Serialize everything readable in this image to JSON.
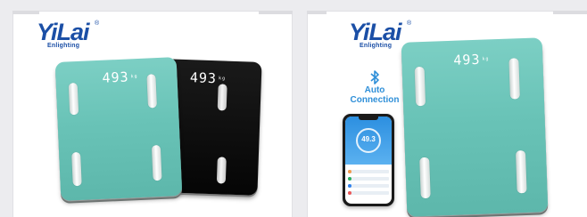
{
  "left_card": {
    "logo": {
      "wordmark": "YiLai",
      "tagline": "Enlighting",
      "reg_mark": "®"
    },
    "teal_scale": {
      "reading": "493",
      "unit": "kg",
      "color": "#69c3b7"
    },
    "black_scale": {
      "reading": "493",
      "unit": "kg",
      "color": "#0a0a0a"
    }
  },
  "right_card": {
    "logo": {
      "wordmark": "YiLai",
      "tagline": "Enlighting",
      "reg_mark": "®"
    },
    "bluetooth": {
      "line1": "Auto",
      "line2": "Connection",
      "icon": "bluetooth-icon",
      "color": "#2f8fd8"
    },
    "phone": {
      "weight": "49.3"
    },
    "teal_scale": {
      "reading": "493",
      "unit": "kg",
      "color": "#69c3b7"
    }
  },
  "colors": {
    "brand": "#1b4fa6",
    "teal": "#69c3b7",
    "bluetooth": "#2f8fd8"
  }
}
